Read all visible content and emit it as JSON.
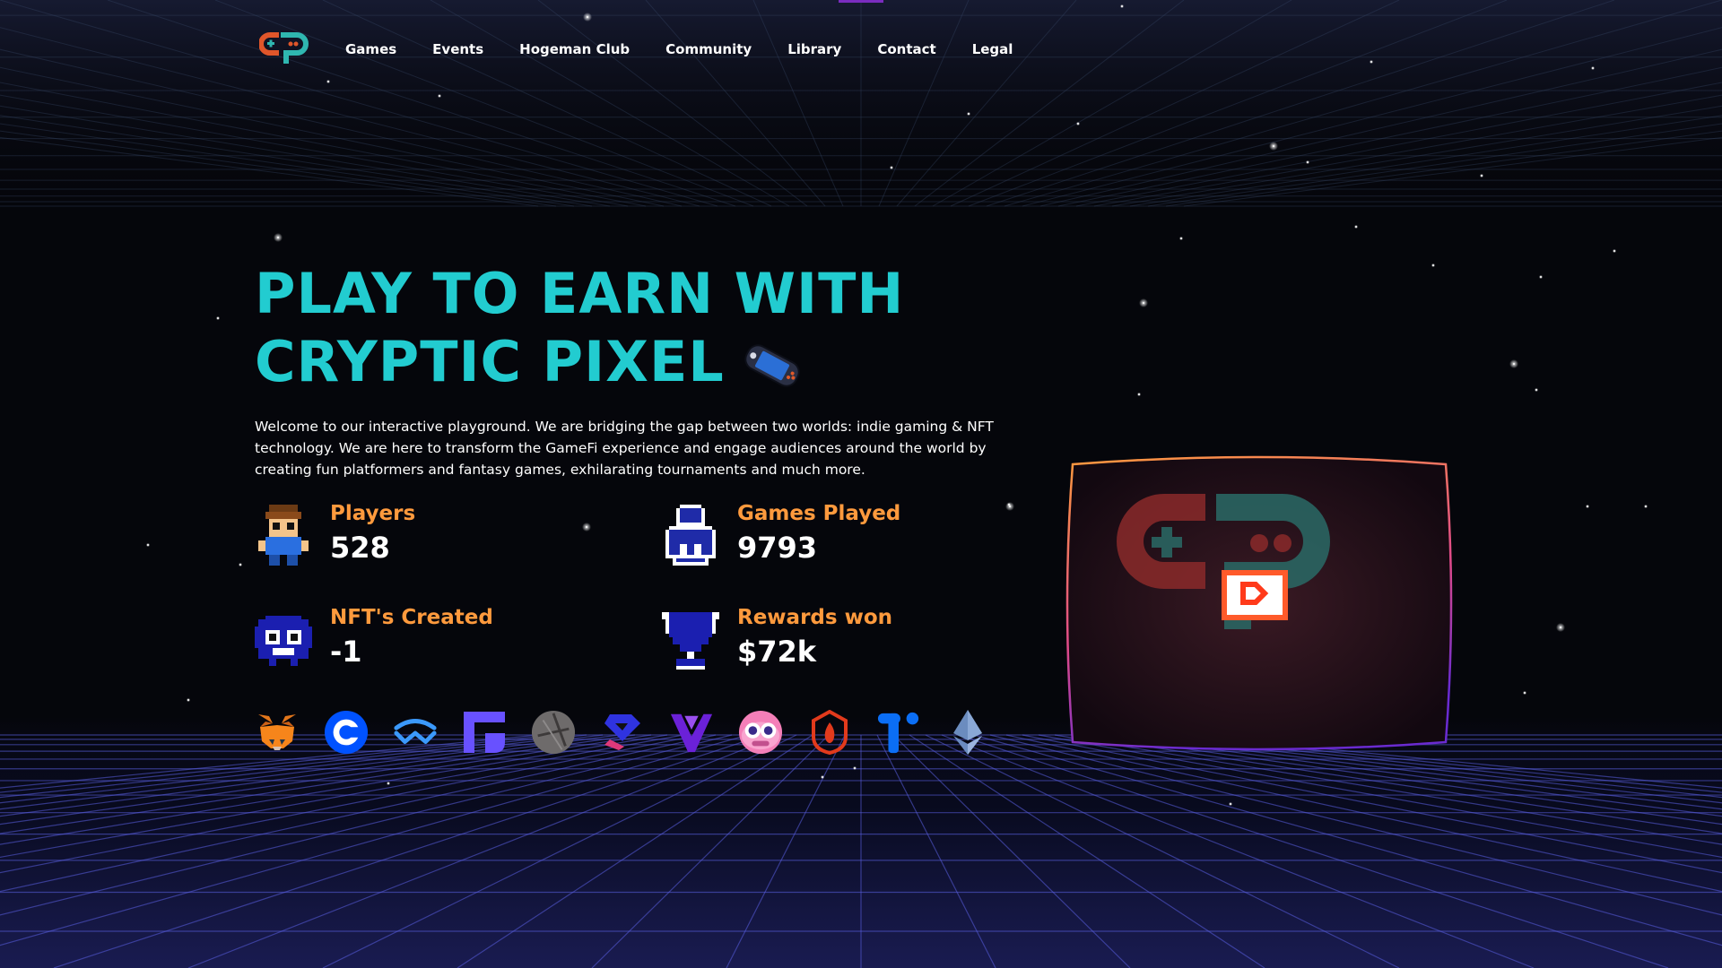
{
  "colors": {
    "accent_cyan": "#22ccd0",
    "accent_orange": "#ff9a3d",
    "grid_purple": "#3b3fa8",
    "background": "#05060b"
  },
  "header": {
    "logo": "cp-logo-icon",
    "nav": [
      {
        "label": "Games"
      },
      {
        "label": "Events"
      },
      {
        "label": "Hogeman Club"
      },
      {
        "label": "Community"
      },
      {
        "label": "Library"
      },
      {
        "label": "Contact"
      },
      {
        "label": "Legal"
      }
    ]
  },
  "hero": {
    "title_line1": "PLAY TO EARN WITH",
    "title_line2": "CRYPTIC PIXEL",
    "title_icon": "handheld-console-icon",
    "description": "Welcome to our interactive playground. We are bridging the gap between two worlds: indie gaming & NFT technology. We are here to transform the GameFi experience and engage audiences around the world by creating fun platformers and fantasy games, exhilarating tournaments and much more."
  },
  "stats": [
    {
      "label": "Players",
      "value": "528",
      "icon": "pixel-player-icon"
    },
    {
      "label": "Games Played",
      "value": "9793",
      "icon": "pixel-person-icon"
    },
    {
      "label": "NFT's Created",
      "value": "-1",
      "icon": "pixel-creature-icon"
    },
    {
      "label": "Rewards won",
      "value": "$72k",
      "icon": "pixel-trophy-icon"
    }
  ],
  "partners": [
    {
      "icon": "metamask-fox-icon"
    },
    {
      "icon": "coinbase-icon"
    },
    {
      "icon": "walletconnect-icon"
    },
    {
      "icon": "fortmatic-icon"
    },
    {
      "icon": "venly-icon"
    },
    {
      "icon": "portis-icon"
    },
    {
      "icon": "vlaunch-icon"
    },
    {
      "icon": "owl-icon"
    },
    {
      "icon": "torus-flame-icon"
    },
    {
      "icon": "trust-icon"
    },
    {
      "icon": "ethereum-icon"
    }
  ],
  "screen": {
    "icon": "cp-logo-crt-icon"
  }
}
